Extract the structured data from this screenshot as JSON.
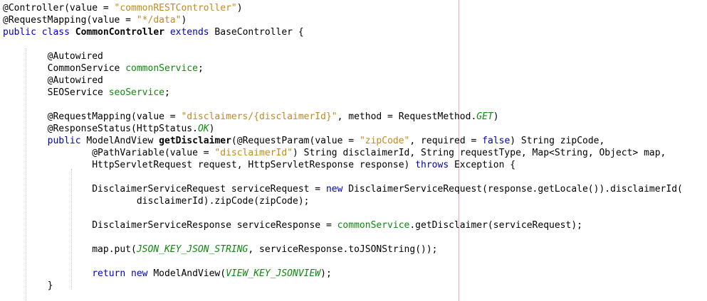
{
  "colors": {
    "keyword": "#0000c0",
    "string": "#c28a1e",
    "field": "#0d8a0d",
    "print_margin": "#f2a6b6",
    "background": "#ffffff"
  },
  "lines": [
    {
      "tokens": [
        {
          "t": "@Controller(value = ",
          "k": "plain"
        },
        {
          "t": "\"commonRESTController\"",
          "k": "str"
        },
        {
          "t": ")",
          "k": "plain"
        }
      ]
    },
    {
      "tokens": [
        {
          "t": "@RequestMapping(value = ",
          "k": "plain"
        },
        {
          "t": "\"*/data\"",
          "k": "str"
        },
        {
          "t": ")",
          "k": "plain"
        }
      ]
    },
    {
      "tokens": [
        {
          "t": "public class ",
          "k": "kw"
        },
        {
          "t": "CommonController",
          "k": "bold"
        },
        {
          "t": " ",
          "k": "plain"
        },
        {
          "t": "extends",
          "k": "kw"
        },
        {
          "t": " BaseController {",
          "k": "plain"
        }
      ]
    },
    {
      "tokens": []
    },
    {
      "tokens": [
        {
          "t": "        @Autowired",
          "k": "plain"
        }
      ]
    },
    {
      "tokens": [
        {
          "t": "        CommonService ",
          "k": "plain"
        },
        {
          "t": "commonService",
          "k": "field"
        },
        {
          "t": ";",
          "k": "plain"
        }
      ]
    },
    {
      "tokens": [
        {
          "t": "        @Autowired",
          "k": "plain"
        }
      ]
    },
    {
      "tokens": [
        {
          "t": "        SEOService ",
          "k": "plain"
        },
        {
          "t": "seoService",
          "k": "field"
        },
        {
          "t": ";",
          "k": "plain"
        }
      ]
    },
    {
      "tokens": []
    },
    {
      "tokens": [
        {
          "t": "        @RequestMapping(value = ",
          "k": "plain"
        },
        {
          "t": "\"disclaimers/{disclaimerId}\"",
          "k": "str"
        },
        {
          "t": ", method = RequestMethod.",
          "k": "plain"
        },
        {
          "t": "GET",
          "k": "const"
        },
        {
          "t": ")",
          "k": "plain"
        }
      ]
    },
    {
      "tokens": [
        {
          "t": "        @ResponseStatus(HttpStatus.",
          "k": "plain"
        },
        {
          "t": "OK",
          "k": "const"
        },
        {
          "t": ")",
          "k": "plain"
        }
      ]
    },
    {
      "tokens": [
        {
          "t": "        ",
          "k": "plain"
        },
        {
          "t": "public",
          "k": "kw"
        },
        {
          "t": " ModelAndView ",
          "k": "plain"
        },
        {
          "t": "getDisclaimer",
          "k": "bold"
        },
        {
          "t": "(@RequestParam(value = ",
          "k": "plain"
        },
        {
          "t": "\"zipCode\"",
          "k": "str"
        },
        {
          "t": ", required = ",
          "k": "plain"
        },
        {
          "t": "false",
          "k": "kw"
        },
        {
          "t": ") String zipCode,",
          "k": "plain"
        }
      ]
    },
    {
      "tokens": [
        {
          "t": "                @PathVariable(value = ",
          "k": "plain"
        },
        {
          "t": "\"disclaimerId\"",
          "k": "str"
        },
        {
          "t": ") String disclaimerId, String requestType, Map<String, Object> map,",
          "k": "plain"
        }
      ]
    },
    {
      "tokens": [
        {
          "t": "                HttpServletRequest request, HttpServletResponse response) ",
          "k": "plain"
        },
        {
          "t": "throws",
          "k": "kw"
        },
        {
          "t": " Exception {",
          "k": "plain"
        }
      ]
    },
    {
      "tokens": []
    },
    {
      "tokens": [
        {
          "t": "                DisclaimerServiceRequest serviceRequest = ",
          "k": "plain"
        },
        {
          "t": "new",
          "k": "kw"
        },
        {
          "t": " DisclaimerServiceRequest(response.getLocale()).disclaimerId(",
          "k": "plain"
        }
      ]
    },
    {
      "tokens": [
        {
          "t": "                        disclaimerId).zipCode(zipCode);",
          "k": "plain"
        }
      ]
    },
    {
      "tokens": []
    },
    {
      "tokens": [
        {
          "t": "                DisclaimerServiceResponse serviceResponse = ",
          "k": "plain"
        },
        {
          "t": "commonService",
          "k": "field"
        },
        {
          "t": ".getDisclaimer(serviceRequest);",
          "k": "plain"
        }
      ]
    },
    {
      "tokens": []
    },
    {
      "tokens": [
        {
          "t": "                map.put(",
          "k": "plain"
        },
        {
          "t": "JSON_KEY_JSON_STRING",
          "k": "const"
        },
        {
          "t": ", serviceResponse.toJSONString());",
          "k": "plain"
        }
      ]
    },
    {
      "tokens": []
    },
    {
      "tokens": [
        {
          "t": "                ",
          "k": "plain"
        },
        {
          "t": "return",
          "k": "kw"
        },
        {
          "t": " ",
          "k": "plain"
        },
        {
          "t": "new",
          "k": "kw"
        },
        {
          "t": " ModelAndView(",
          "k": "plain"
        },
        {
          "t": "VIEW_KEY_JSONVIEW",
          "k": "const"
        },
        {
          "t": ");",
          "k": "plain"
        }
      ]
    },
    {
      "tokens": [
        {
          "t": "        }",
          "k": "plain"
        }
      ]
    }
  ]
}
